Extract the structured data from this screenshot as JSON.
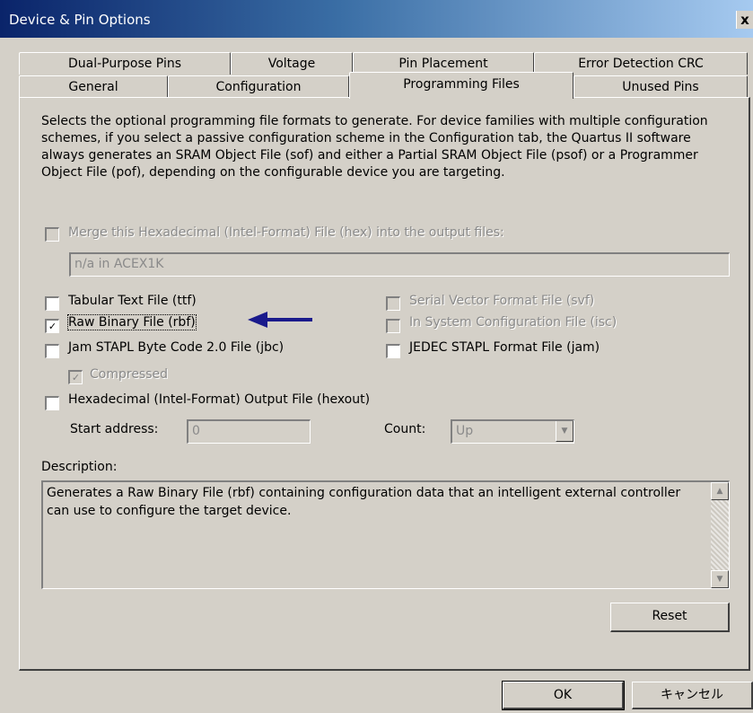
{
  "window": {
    "title": "Device & Pin Options",
    "close": "x"
  },
  "tabs_row1": [
    "Dual-Purpose Pins",
    "Voltage",
    "Pin Placement",
    "Error Detection CRC"
  ],
  "tabs_row2": [
    "General",
    "Configuration",
    "Programming Files",
    "Unused Pins"
  ],
  "active_tab": "Programming Files",
  "intro": "Selects the optional programming file formats to generate.  For device families with multiple configuration schemes, if you select a passive configuration scheme in the Configuration tab, the Quartus II software always generates an SRAM Object File (sof) and either a Partial SRAM Object File (psof) or a Programmer Object File (pof), depending on the configurable device you are targeting.",
  "merge": {
    "label": "Merge this Hexadecimal (Intel-Format) File (hex) into the output files:",
    "value": "n/a in ACEX1K"
  },
  "options": {
    "ttf": {
      "label": "Tabular Text File (ttf)"
    },
    "rbf": {
      "label": "Raw Binary File (rbf)"
    },
    "jbc": {
      "label": "Jam STAPL Byte Code 2.0 File (jbc)"
    },
    "compressed": {
      "label": "Compressed"
    },
    "hexout": {
      "label": "Hexadecimal (Intel-Format) Output File (hexout)"
    },
    "svf": {
      "label": "Serial Vector Format File (svf)"
    },
    "isc": {
      "label": "In System Configuration File (isc)"
    },
    "jam": {
      "label": "JEDEC STAPL Format File (jam)"
    }
  },
  "start_address": {
    "label": "Start address:",
    "value": "0"
  },
  "count": {
    "label": "Count:",
    "value": "Up"
  },
  "description": {
    "label": "Description:",
    "text": "Generates a Raw Binary File (rbf) containing configuration data that an intelligent external controller can use to configure the target device."
  },
  "buttons": {
    "reset": "Reset",
    "ok": "OK",
    "cancel": "キャンセル"
  },
  "colors": {
    "title_start": "#0a246a",
    "title_end": "#a6caf0",
    "arrow": "#1a1a8c",
    "face": "#d4d0c8"
  }
}
